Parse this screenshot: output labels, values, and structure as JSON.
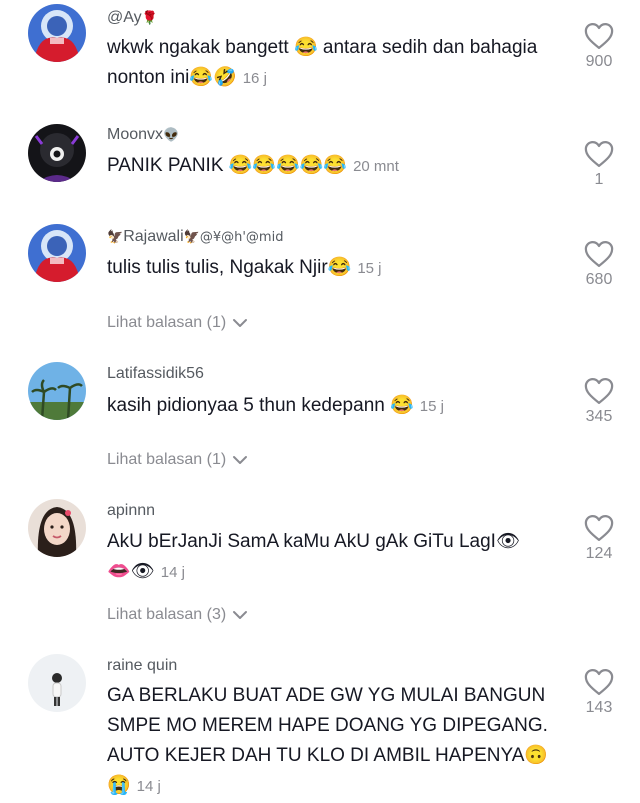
{
  "comments": [
    {
      "username": "@Ay",
      "username_suffix": "🌹",
      "text": "wkwk ngakak bangett 😂 antara sedih dan bahagia nonton ini😂🤣",
      "time": "16 j",
      "likes": "900"
    },
    {
      "username": "Moonvx",
      "username_suffix": "👽",
      "text": "PANIK PANIK 😂😂😂😂😂",
      "time": "20 mnt",
      "likes": "1"
    },
    {
      "username_prefix": "🦅",
      "username": "Rajawali",
      "username_suffix": "🦅@¥@h'@mid",
      "text": "tulis tulis tulis, Ngakak Njir😂",
      "time": "15 j",
      "likes": "680",
      "replies": "Lihat balasan (1)"
    },
    {
      "username": "Latifassidik56",
      "text": "kasih pidionyaa 5 thun kedepann 😂",
      "time": "15 j",
      "likes": "345",
      "replies": "Lihat balasan (1)"
    },
    {
      "username": "apinnn",
      "text_line1": "AkU bErJanJi SamA kaMu AkU gAk GiTu LagI👁",
      "text_line2": "👄👁",
      "time": "14 j",
      "likes": "124",
      "replies": "Lihat balasan (3)"
    },
    {
      "username": "raine quin",
      "text": "GA BERLAKU BUAT ADE GW YG MULAI BANGUN SMPE MO MEREM HAPE DOANG YG DIPEGANG. AUTO KEJER DAH TU KLO DI AMBIL HAPENYA🙃😭",
      "time": "14 j",
      "likes": "143"
    }
  ],
  "icons": {
    "like": "heart-outline-icon",
    "expand": "chevron-down-icon"
  },
  "colors": {
    "primary_text": "#161823",
    "secondary_text": "#8a8b91",
    "username": "#555a60"
  }
}
